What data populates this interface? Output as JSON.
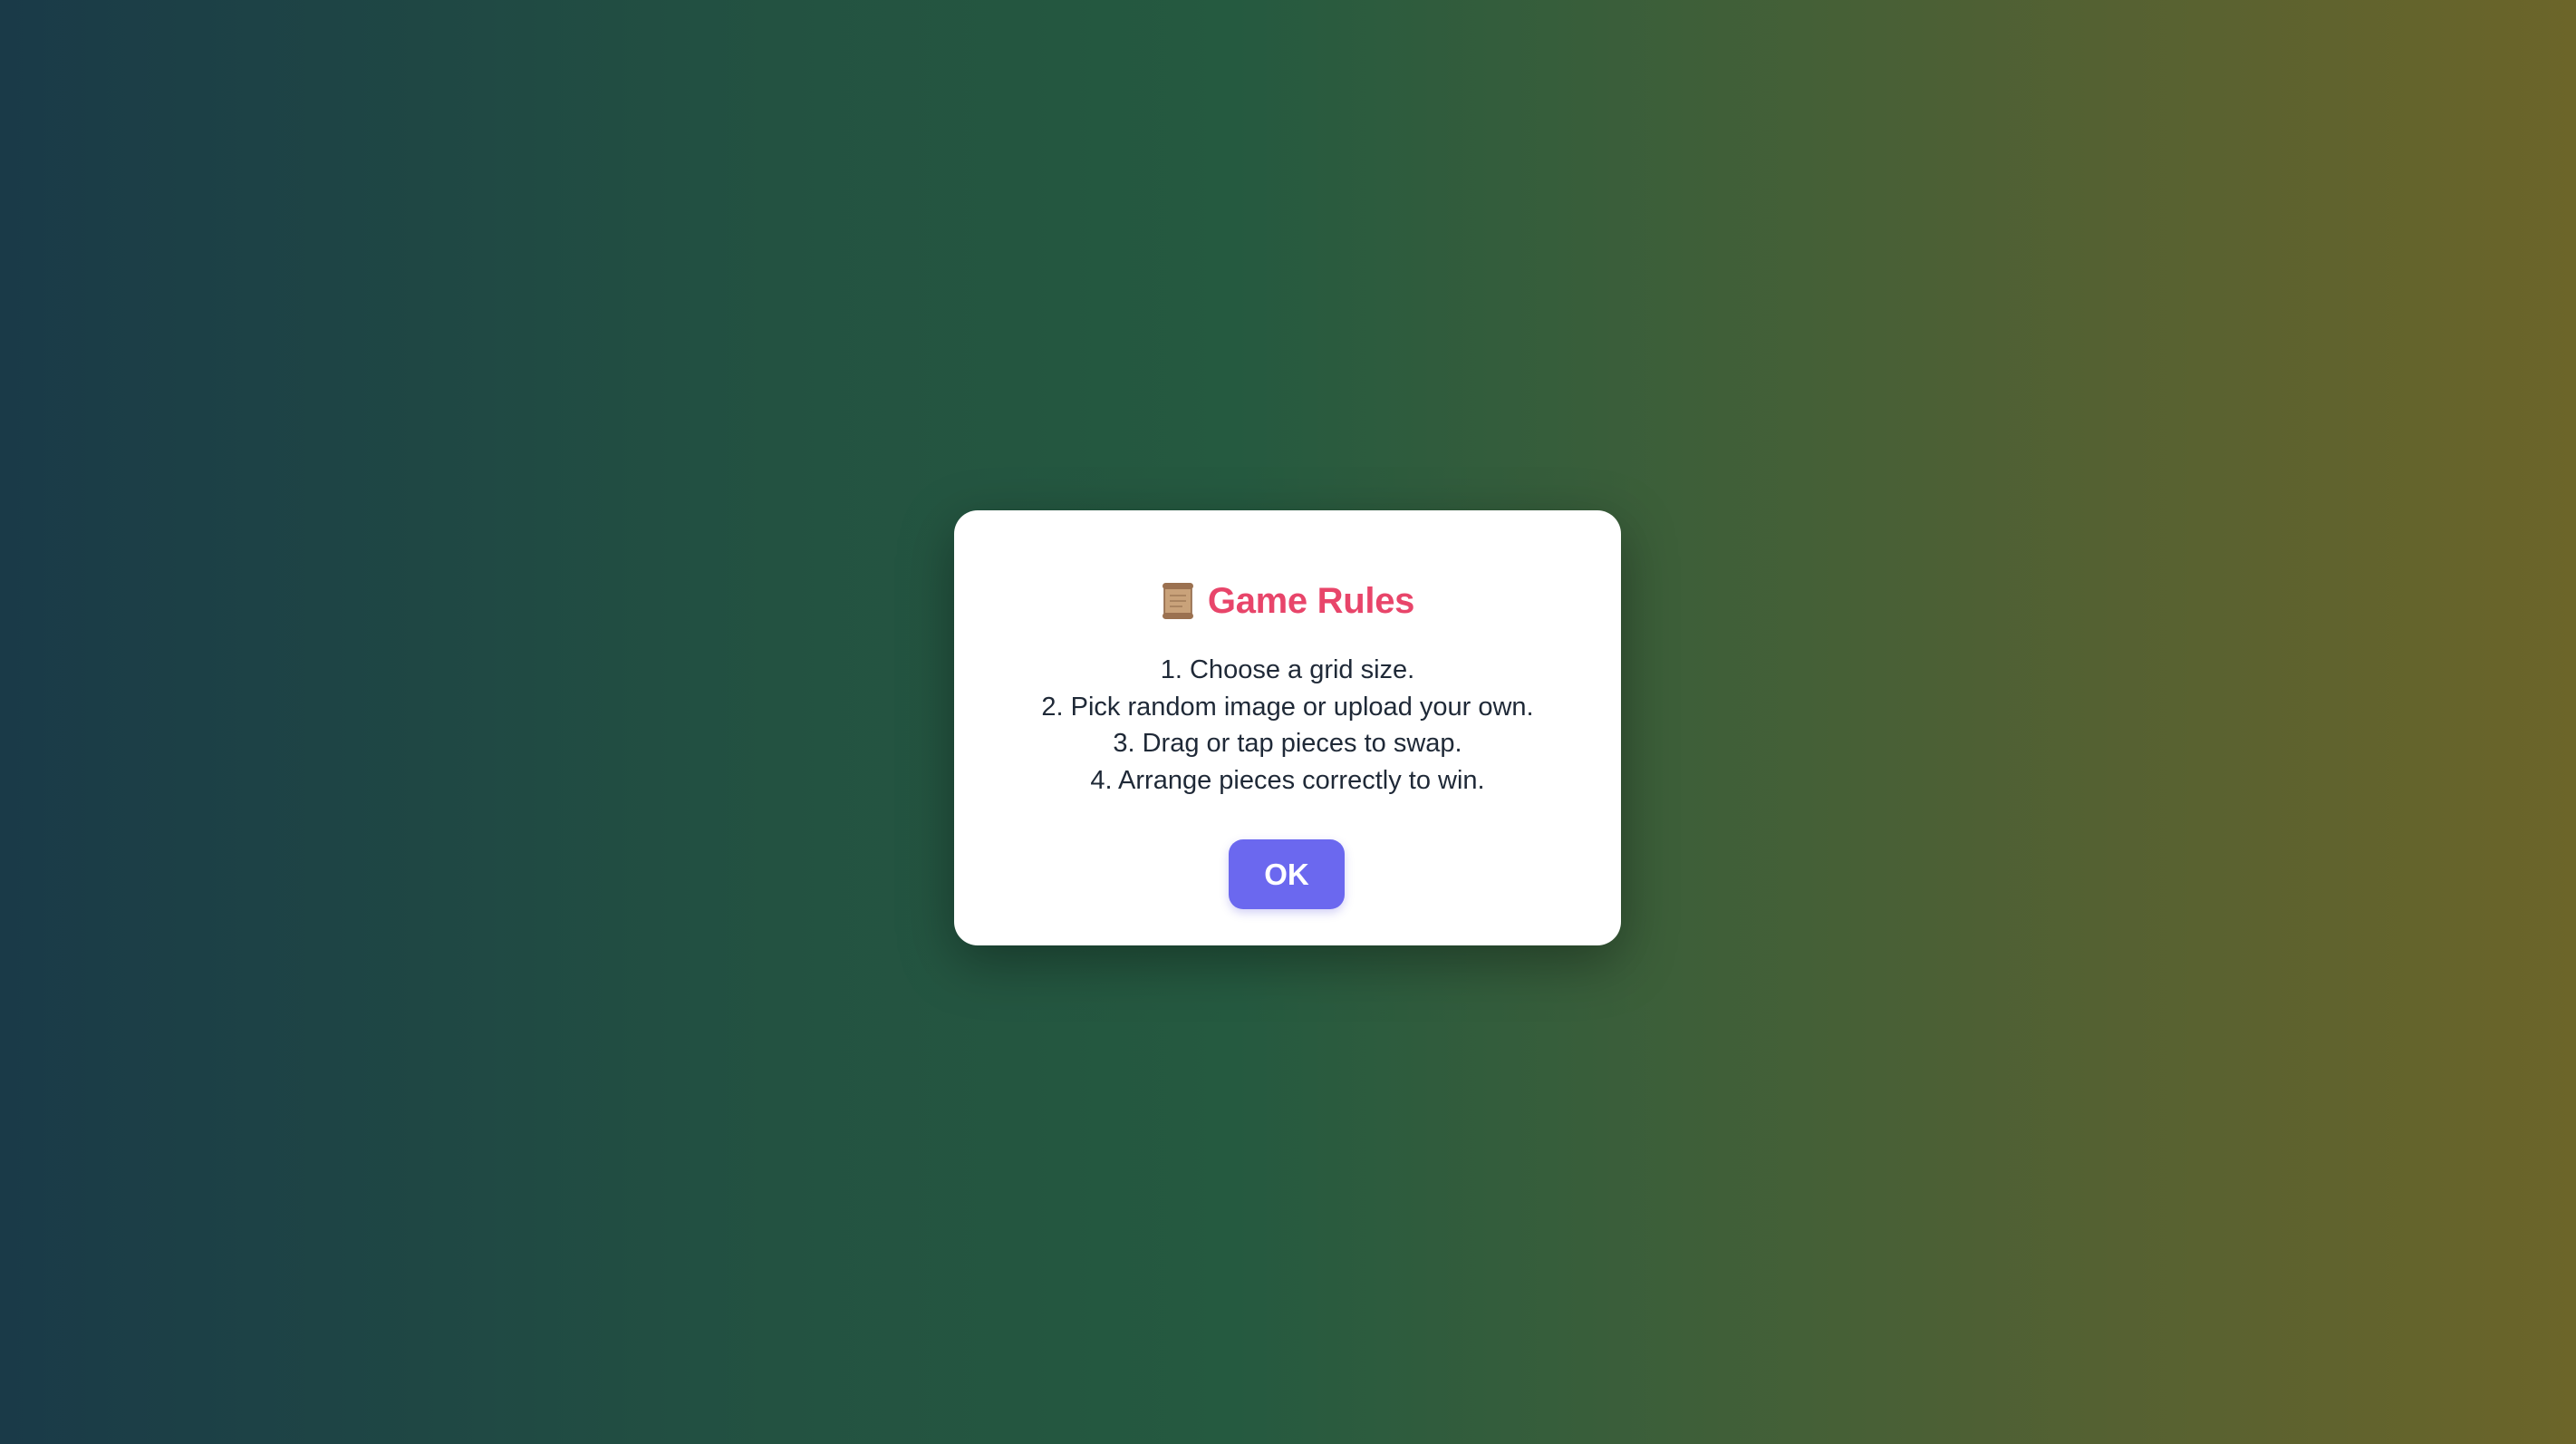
{
  "modal": {
    "title_icon": "scroll-icon",
    "title": "Game Rules",
    "rules": [
      "1. Choose a grid size.",
      "2. Pick random image or upload your own.",
      "3. Drag or tap pieces to swap.",
      "4. Arrange pieces correctly to win."
    ],
    "ok_label": "OK"
  },
  "colors": {
    "title": "#e8456a",
    "button": "#6b68ef",
    "text": "#1f2937",
    "background_left": "#1a3a48",
    "background_right": "#6c6529"
  }
}
